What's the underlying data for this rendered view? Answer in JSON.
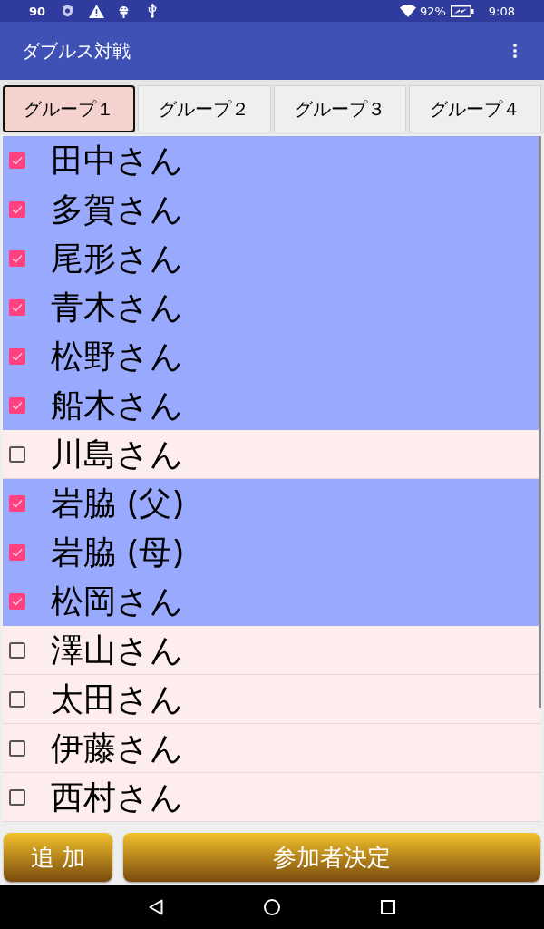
{
  "status_bar": {
    "notification_count": "90",
    "battery_percent": "92%",
    "time": "9:08"
  },
  "app_bar": {
    "title": "ダブルス対戦"
  },
  "tabs": [
    {
      "label": "グループ１",
      "selected": true
    },
    {
      "label": "グループ２",
      "selected": false
    },
    {
      "label": "グループ３",
      "selected": false
    },
    {
      "label": "グループ４",
      "selected": false
    }
  ],
  "players": [
    {
      "name": "田中さん",
      "checked": true
    },
    {
      "name": "多賀さん",
      "checked": true
    },
    {
      "name": "尾形さん",
      "checked": true
    },
    {
      "name": "青木さん",
      "checked": true
    },
    {
      "name": "松野さん",
      "checked": true
    },
    {
      "name": "船木さん",
      "checked": true
    },
    {
      "name": "川島さん",
      "checked": false
    },
    {
      "name": "岩脇 (父)",
      "checked": true
    },
    {
      "name": "岩脇 (母)",
      "checked": true
    },
    {
      "name": "松岡さん",
      "checked": true
    },
    {
      "name": "澤山さん",
      "checked": false
    },
    {
      "name": "太田さん",
      "checked": false
    },
    {
      "name": "伊藤さん",
      "checked": false
    },
    {
      "name": "西村さん",
      "checked": false
    }
  ],
  "buttons": [
    {
      "label": "追 加"
    },
    {
      "label": "参加者決定"
    }
  ]
}
